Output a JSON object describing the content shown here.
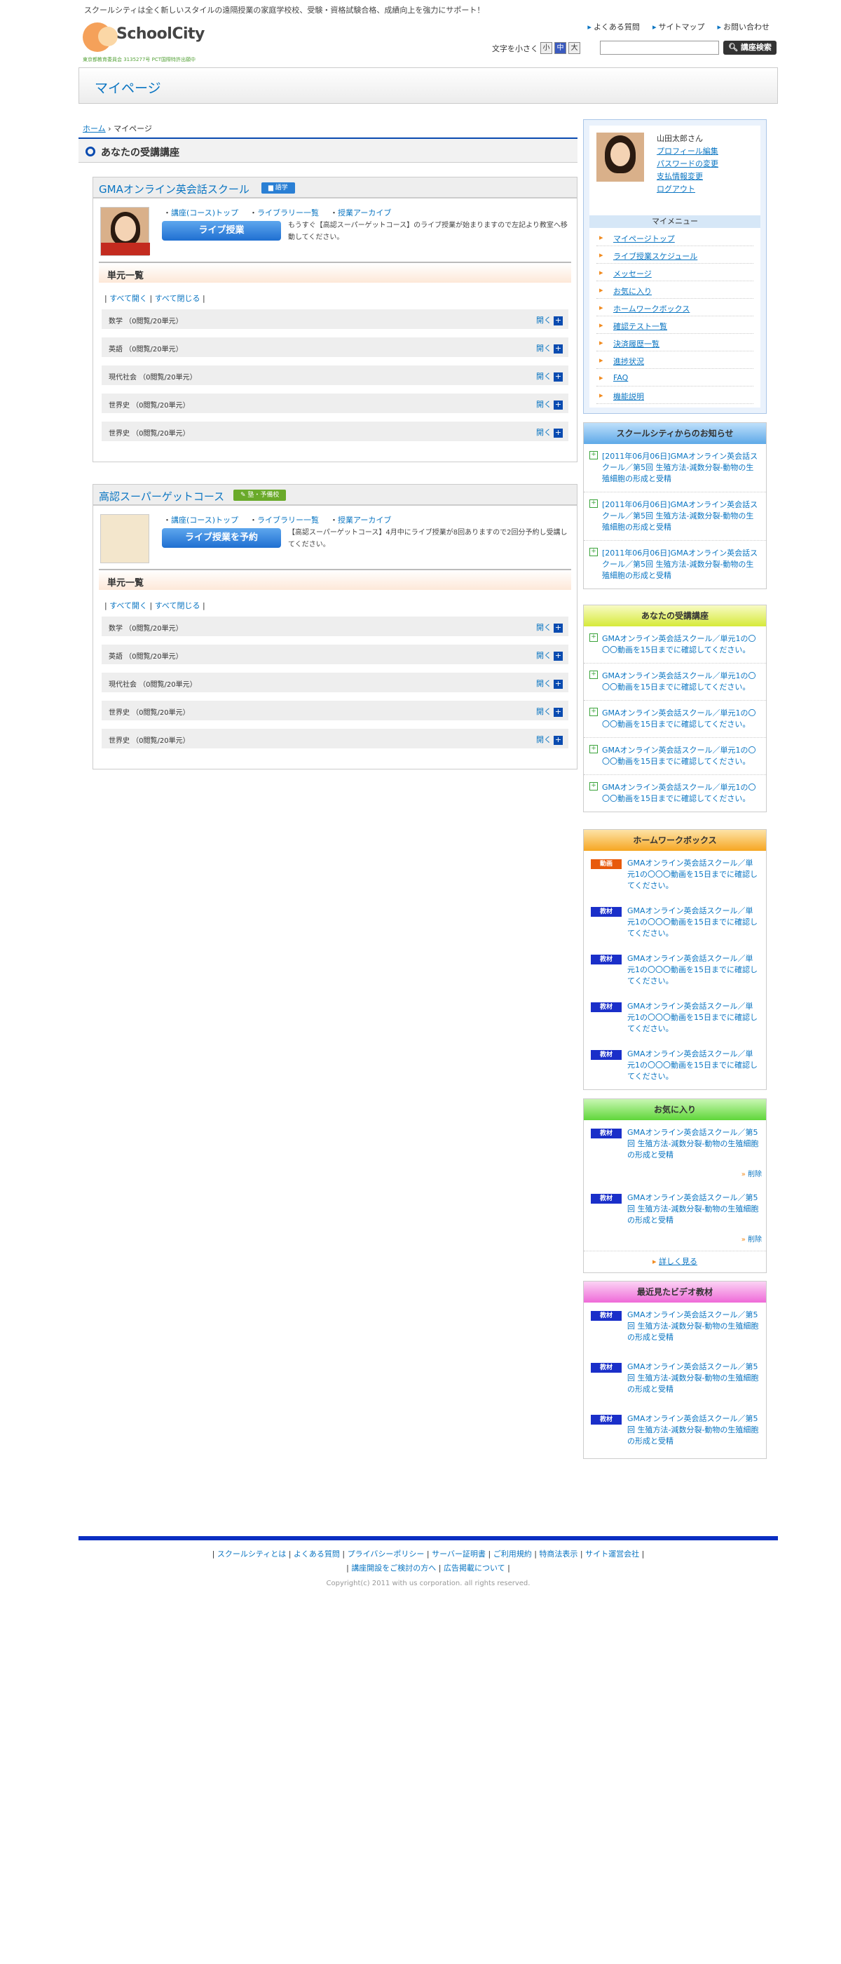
{
  "header": {
    "tagline": "スクールシティは全く新しいスタイルの遠隔授業の家庭学校校、受験・資格試験合格、成績向上を強力にサポート！",
    "logo_text": "SchoolCity",
    "logo_sub": "東京都教育委員会 3135277号 PCT国際特許出願中",
    "links": [
      "よくある質問",
      "サイトマップ",
      "お問い合わせ"
    ],
    "font_size_label": "文字を小さく",
    "sizes": [
      "小",
      "中",
      "大"
    ],
    "search_button": "講座検索"
  },
  "page_title": "マイページ",
  "breadcrumb": {
    "home": "ホーム",
    "current": "マイページ"
  },
  "section_title": "あなたの受講講座",
  "courses": [
    {
      "name": "GMAオンライン英会話スクール",
      "badge": "語学",
      "badge_color": "#2a7fd4",
      "links": [
        "講座(コース)トップ",
        "ライブラリー一覧",
        "授業アーカイブ"
      ],
      "button": "ライブ授業",
      "desc": "もうすぐ【高認スーパーゲットコース】のライブ授業が始まりますので左記より教室へ移動してください。",
      "units_title": "単元一覧",
      "expand_all": "すべて開く",
      "collapse_all": "すべて閉じる",
      "units": [
        {
          "name": "数学 （0閲覧/20単元）"
        },
        {
          "name": "英語 （0閲覧/20単元）"
        },
        {
          "name": "現代社会 （0閲覧/20単元）"
        },
        {
          "name": "世界史 （0閲覧/20単元）"
        },
        {
          "name": "世界史 （0閲覧/20単元）"
        }
      ],
      "open": "開く"
    },
    {
      "name": "高認スーパーゲットコース",
      "badge": "塾・予備校",
      "badge_color": "#6aaa2a",
      "links": [
        "講座(コース)トップ",
        "ライブラリー一覧",
        "授業アーカイブ"
      ],
      "button": "ライブ授業を予約",
      "desc": "【高認スーパーゲットコース】4月中にライブ授業が8回ありますので2回分予約し受講してください。",
      "units_title": "単元一覧",
      "expand_all": "すべて開く",
      "collapse_all": "すべて閉じる",
      "units": [
        {
          "name": "数学 （0閲覧/20単元）"
        },
        {
          "name": "英語 （0閲覧/20単元）"
        },
        {
          "name": "現代社会 （0閲覧/20単元）"
        },
        {
          "name": "世界史 （0閲覧/20単元）"
        },
        {
          "name": "世界史 （0閲覧/20単元）"
        }
      ],
      "open": "開く"
    }
  ],
  "profile": {
    "name": "山田太郎さん",
    "links": [
      "プロフィール編集",
      "パスワードの変更",
      "支払情報変更",
      "ログアウト"
    ],
    "menu_title": "マイメニュー",
    "menu": [
      "マイページトップ",
      "ライブ授業スケジュール",
      "メッセージ",
      "お気に入り",
      "ホームワークボックス",
      "確認テスト一覧",
      "決済履歴一覧",
      "進捗状況",
      "FAQ",
      "機能説明"
    ]
  },
  "news": {
    "title": "スクールシティからのお知らせ",
    "items": [
      "[2011年06月06日]GMAオンライン英会話スクール／第5回 生殖方法-減数分裂-動物の生殖細胞の形成と受精",
      "[2011年06月06日]GMAオンライン英会話スクール／第5回 生殖方法-減数分裂-動物の生殖細胞の形成と受精",
      "[2011年06月06日]GMAオンライン英会話スクール／第5回 生殖方法-減数分裂-動物の生殖細胞の形成と受精"
    ]
  },
  "courses_box": {
    "title": "あなたの受講講座",
    "items": [
      "GMAオンライン英会話スクール／単元1の〇〇〇動画を15日までに確認してください。",
      "GMAオンライン英会話スクール／単元1の〇〇〇動画を15日までに確認してください。",
      "GMAオンライン英会話スクール／単元1の〇〇〇動画を15日までに確認してください。",
      "GMAオンライン英会話スクール／単元1の〇〇〇動画を15日までに確認してください。",
      "GMAオンライン英会話スクール／単元1の〇〇〇動画を15日までに確認してください。"
    ]
  },
  "homework": {
    "title": "ホームワークボックス",
    "items": [
      {
        "tag": "動画",
        "text": "GMAオンライン英会話スクール／単元1の〇〇〇動画を15日までに確認してください。"
      },
      {
        "tag": "教材",
        "text": "GMAオンライン英会話スクール／単元1の〇〇〇動画を15日までに確認してください。"
      },
      {
        "tag": "教材",
        "text": "GMAオンライン英会話スクール／単元1の〇〇〇動画を15日までに確認してください。"
      },
      {
        "tag": "教材",
        "text": "GMAオンライン英会話スクール／単元1の〇〇〇動画を15日までに確認してください。"
      },
      {
        "tag": "教材",
        "text": "GMAオンライン英会話スクール／単元1の〇〇〇動画を15日までに確認してください。"
      }
    ]
  },
  "favorites": {
    "title": "お気に入り",
    "items": [
      {
        "tag": "教材",
        "text": "GMAオンライン英会話スクール／第5回 生殖方法-減数分裂-動物の生殖細胞の形成と受精",
        "del": "削除"
      },
      {
        "tag": "教材",
        "text": "GMAオンライン英会話スクール／第5回 生殖方法-減数分裂-動物の生殖細胞の形成と受精",
        "del": "削除"
      }
    ],
    "more": "詳しく見る"
  },
  "recent": {
    "title": "最近見たビデオ教材",
    "items": [
      {
        "tag": "教材",
        "text": "GMAオンライン英会話スクール／第5回 生殖方法-減数分裂-動物の生殖細胞の形成と受精"
      },
      {
        "tag": "教材",
        "text": "GMAオンライン英会話スクール／第5回 生殖方法-減数分裂-動物の生殖細胞の形成と受精"
      },
      {
        "tag": "教材",
        "text": "GMAオンライン英会話スクール／第5回 生殖方法-減数分裂-動物の生殖細胞の形成と受精"
      }
    ]
  },
  "footer": {
    "links1": [
      "スクールシティとは",
      "よくある質問",
      "プライバシーポリシー",
      "サーバー証明書",
      "ご利用規約",
      "特商法表示",
      "サイト運営会社"
    ],
    "links2": [
      "講座開設をご検討の方へ",
      "広告掲載について"
    ],
    "copyright": "Copyright(c) 2011 with us corporation. all rights reserved."
  }
}
